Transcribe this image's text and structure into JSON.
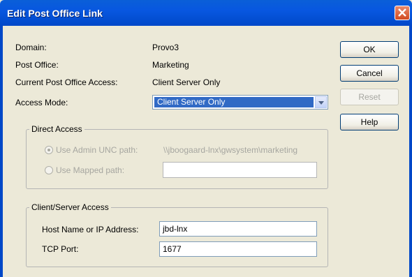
{
  "window": {
    "title": "Edit Post Office Link",
    "close_icon": "close-icon"
  },
  "info": {
    "domain_label": "Domain:",
    "domain_value": "Provo3",
    "post_office_label": "Post Office:",
    "post_office_value": "Marketing",
    "current_access_label": "Current Post Office Access:",
    "current_access_value": "Client Server Only",
    "access_mode_label": "Access Mode:",
    "access_mode_value": "Client Server Only"
  },
  "direct_access": {
    "legend": "Direct Access",
    "admin_unc_label": "Use Admin UNC path:",
    "admin_unc_value": "\\\\jboogaard-lnx\\gwsystem\\marketing",
    "mapped_label": "Use Mapped path:",
    "mapped_value": "",
    "selected": "admin_unc"
  },
  "client_server": {
    "legend": "Client/Server Access",
    "host_label": "Host Name or IP Address:",
    "host_value": "jbd-lnx",
    "port_label": "TCP Port:",
    "port_value": "1677"
  },
  "buttons": {
    "ok": "OK",
    "cancel": "Cancel",
    "reset": "Reset",
    "help": "Help"
  },
  "colors": {
    "titlebar": "#0a5fd8",
    "selection": "#316ac5",
    "close": "#d24a20"
  }
}
